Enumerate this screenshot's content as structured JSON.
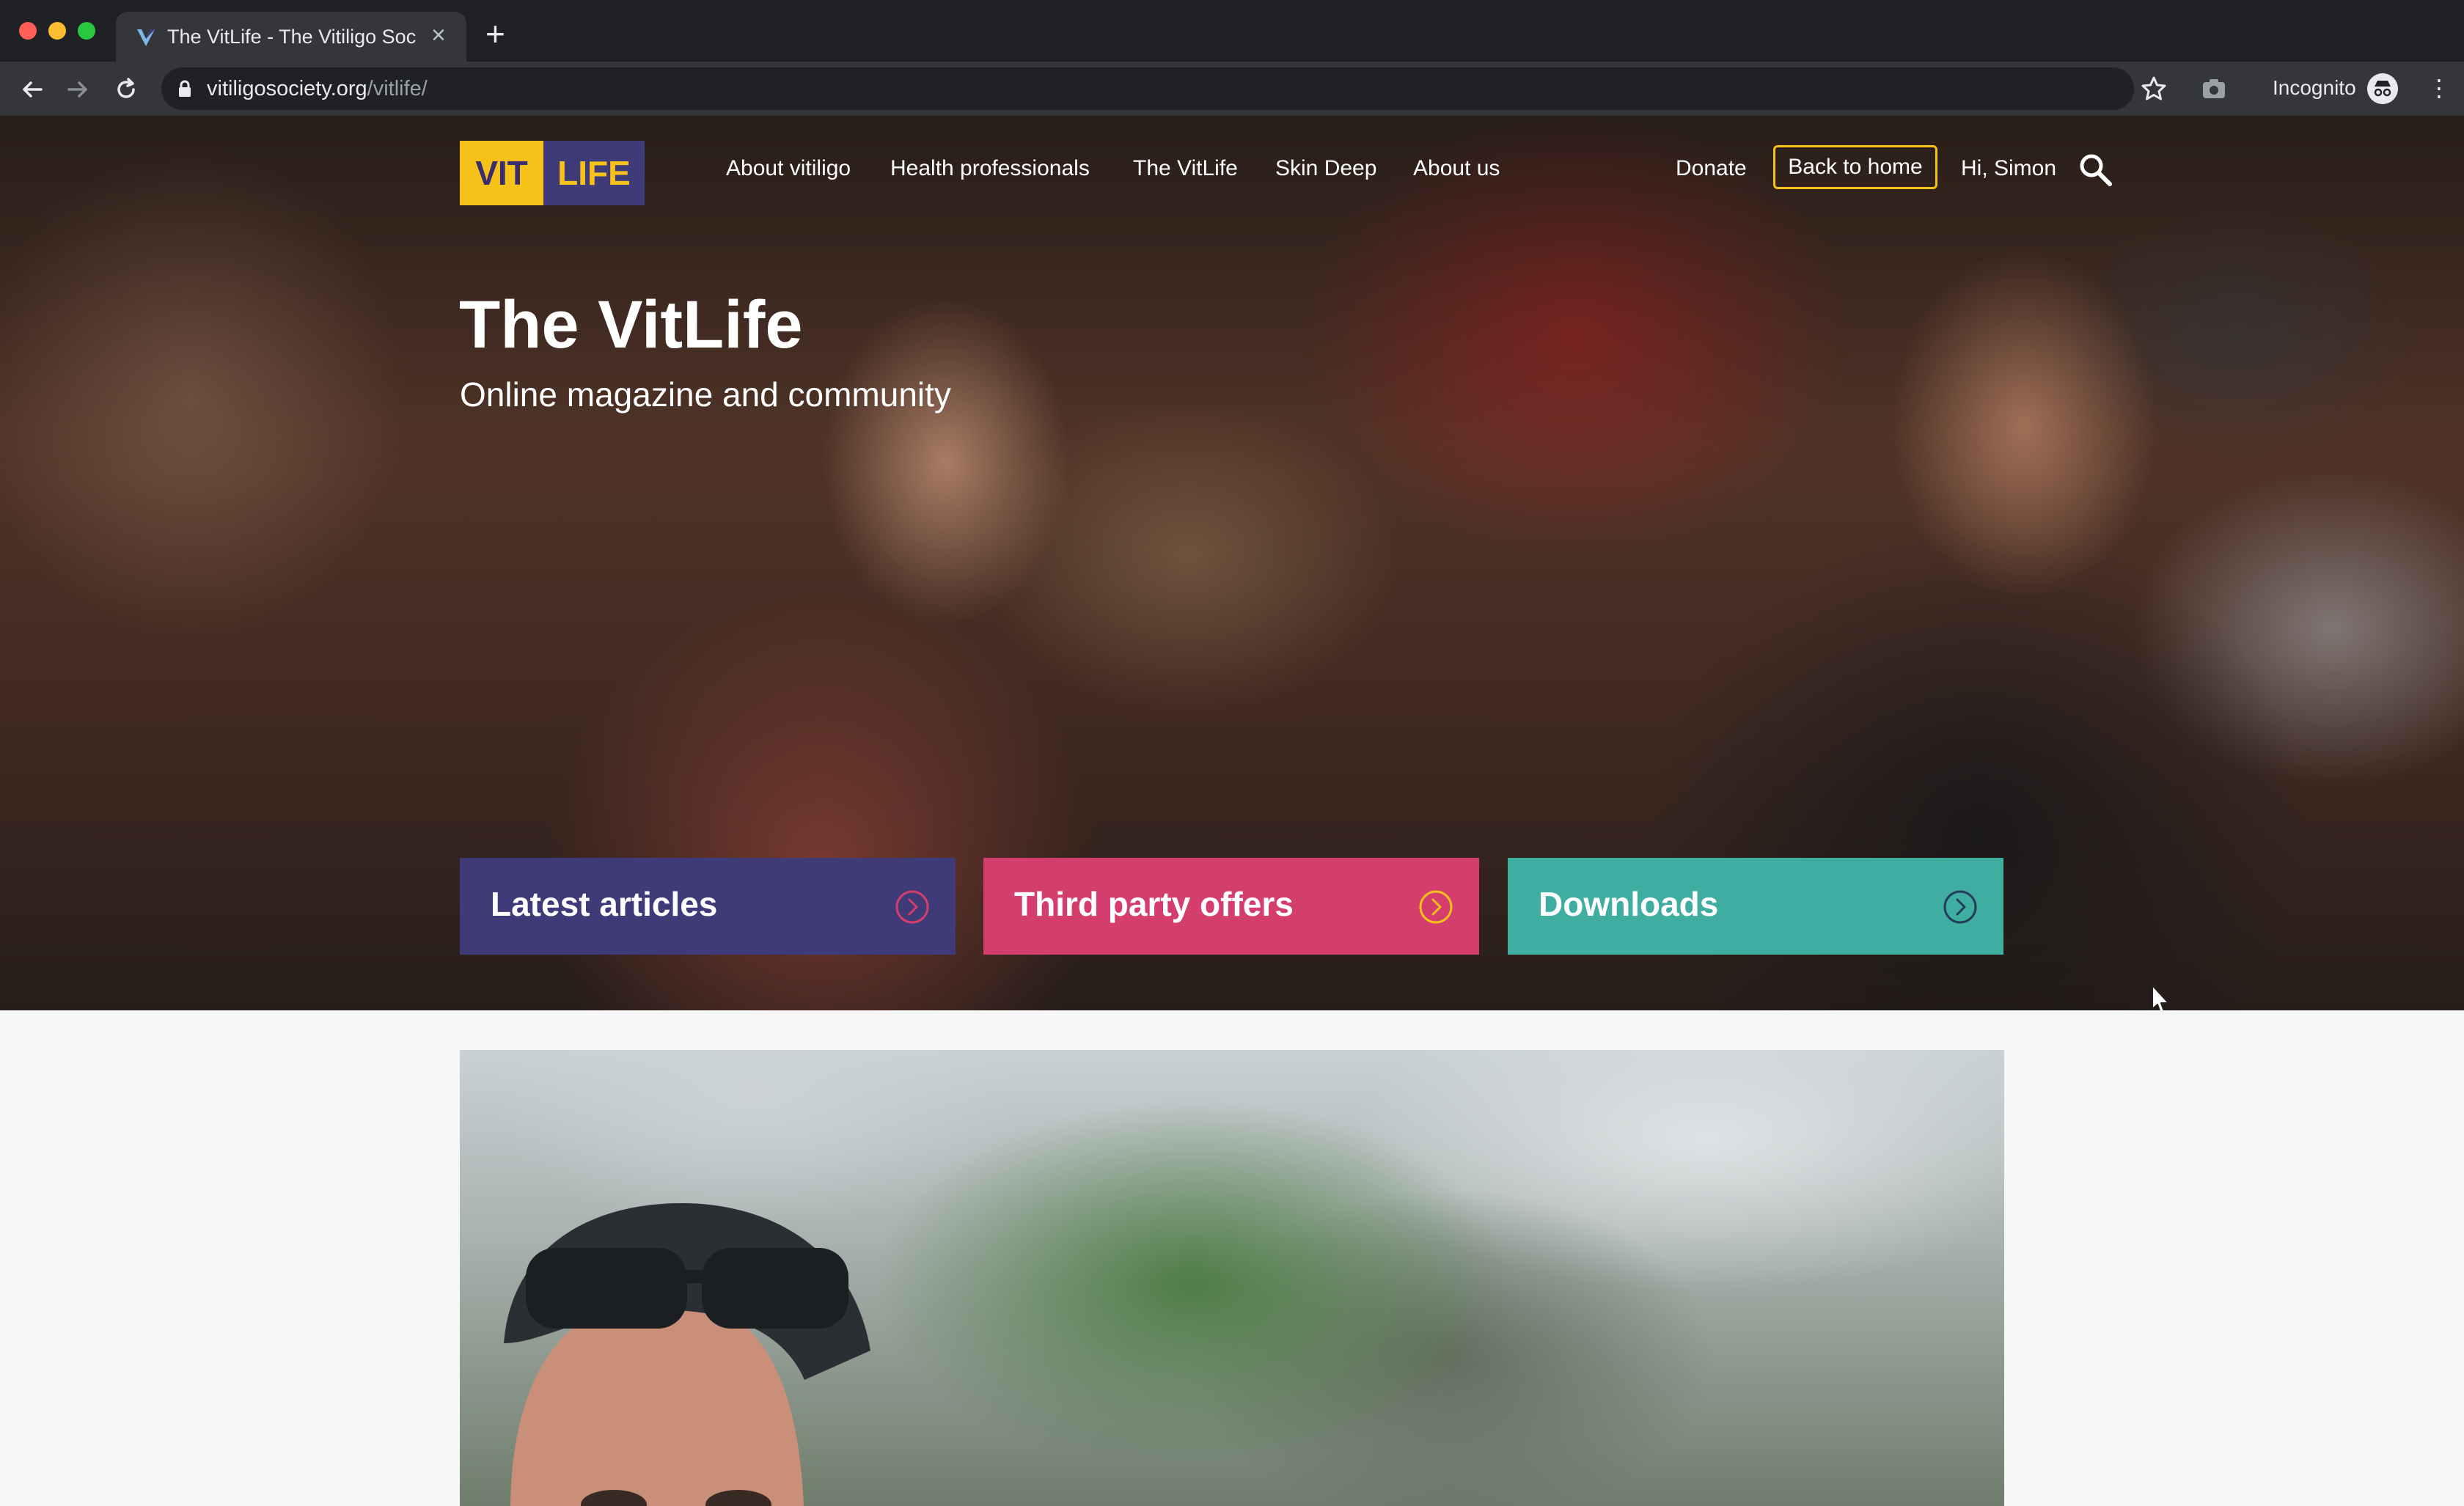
{
  "browser": {
    "tab_title": "The VitLife - The Vitiligo Society",
    "url_host": "vitiligosociety.org",
    "url_path": "/vitlife/",
    "incognito_label": "Incognito"
  },
  "site": {
    "logo": {
      "left": "VIT",
      "right": "LIFE"
    },
    "nav": [
      "About vitiligo",
      "Health professionals",
      "The VitLife",
      "Skin Deep",
      "About us"
    ],
    "donate": "Donate",
    "back_home": "Back to home",
    "greeting": "Hi, Simon"
  },
  "hero": {
    "title": "The VitLife",
    "subtitle": "Online magazine and community",
    "cards": [
      {
        "label": "Latest articles",
        "color": "#3f3a78"
      },
      {
        "label": "Third party offers",
        "color": "#d43e6c"
      },
      {
        "label": "Downloads",
        "color": "#3fada0"
      }
    ]
  },
  "colors": {
    "accent_yellow": "#f6c21a",
    "brand_purple": "#3f3a78"
  }
}
